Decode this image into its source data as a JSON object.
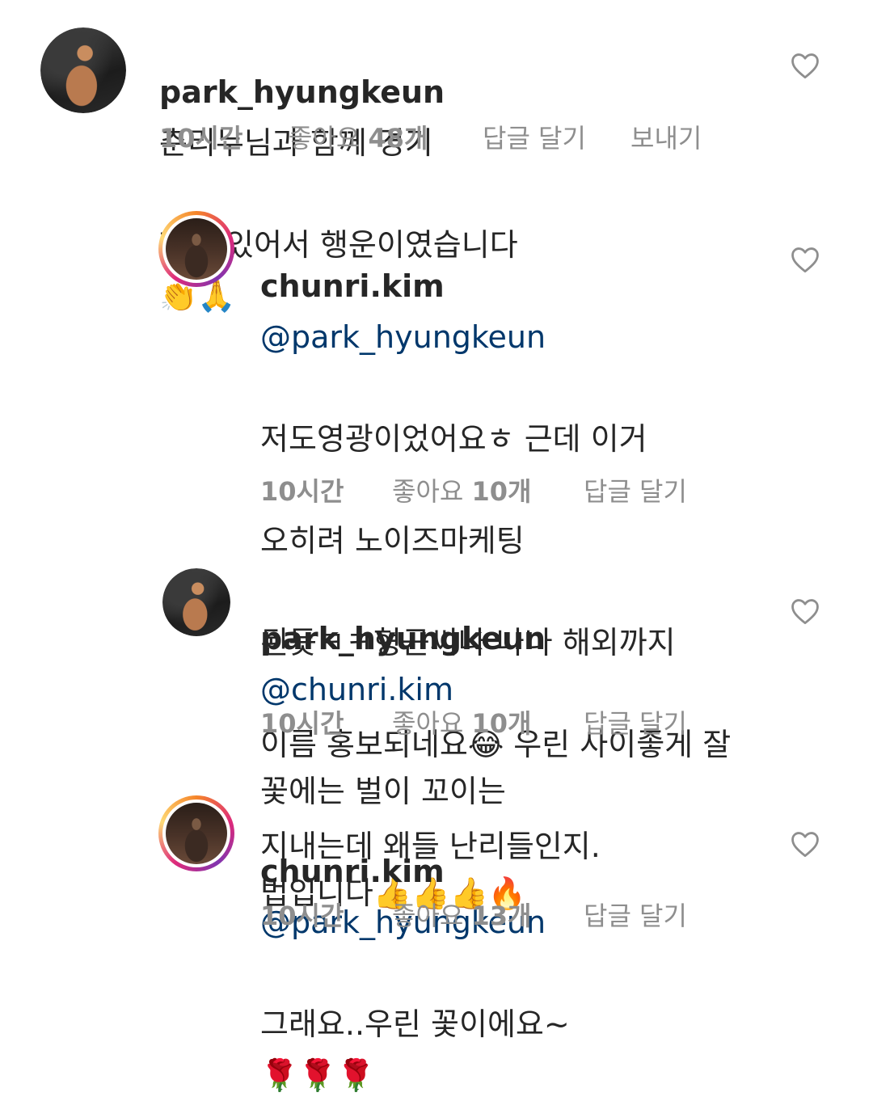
{
  "comments": [
    {
      "username": "park_hyungkeun",
      "mention": "",
      "text_line1": "춘리누님과 함께 경기",
      "text_line2": "할수 있어서 행운이였습니다",
      "emoji": "👏🙏",
      "time": "10시간",
      "likes_label": "좋아요",
      "likes_count": "48개",
      "reply_label": "답글 달기",
      "send_label": "보내기"
    },
    {
      "username": "chunri.kim",
      "mention": "@park_hyungkeun",
      "line1": "저도영광이었어요ㅎ 근데 이거",
      "line2": "오히려 노이즈마케팅",
      "line3": "된듯ㅋㅋ형근씨나 나나 해외까지",
      "line4a": "이름 홍보되네요",
      "line4_emoji": "😂",
      "line4b": " 우린 사이좋게 잘",
      "line5": "지내는데 왜들 난리들인지.",
      "time": "10시간",
      "likes_label": "좋아요",
      "likes_count": "10개",
      "reply_label": "답글 달기"
    },
    {
      "username": "park_hyungkeun",
      "mention": "@chunri.kim",
      "line1": "꽃에는 벌이 꼬이는",
      "line2": "법입니다",
      "emoji": "👍👍👍🔥",
      "time": "10시간",
      "likes_label": "좋아요",
      "likes_count": "10개",
      "reply_label": "답글 달기"
    },
    {
      "username": "chunri.kim",
      "mention": "@park_hyungkeun",
      "line1": "그래요..우린 꽃이에요~",
      "emoji": "🌹🌹🌹",
      "time": "10시간",
      "likes_label": "좋아요",
      "likes_count": "13개",
      "reply_label": "답글 달기"
    }
  ],
  "icons": {
    "avatar_park": "avatar-photo",
    "avatar_chunri": "avatar-photo-story-ring",
    "like": "heart-outline-icon"
  },
  "colors": {
    "text": "#262626",
    "meta": "#8e8e8e",
    "mention": "#00376b",
    "story_ring": "#dd2a7b"
  }
}
